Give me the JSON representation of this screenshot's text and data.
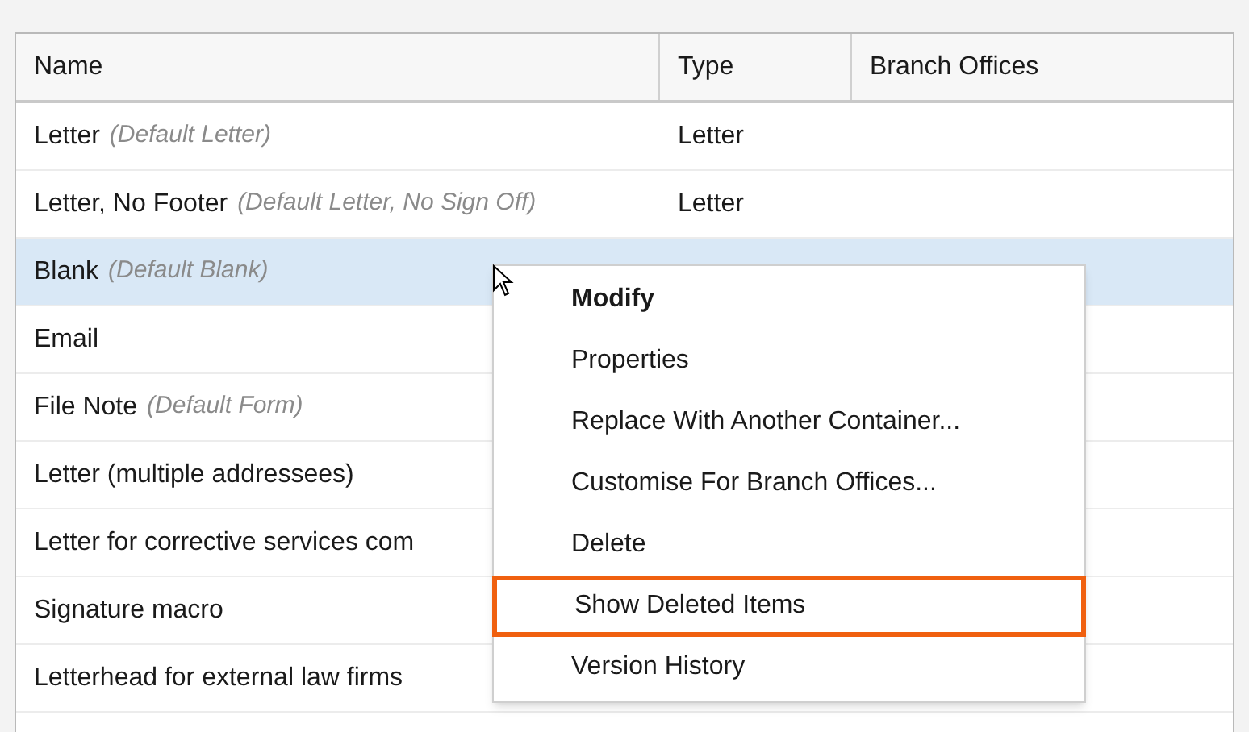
{
  "table": {
    "columns": [
      "Name",
      "Type",
      "Branch Offices"
    ],
    "rows": [
      {
        "name": "Letter",
        "note": "(Default Letter)",
        "type": "Letter",
        "selected": false
      },
      {
        "name": "Letter, No Footer",
        "note": "(Default Letter, No Sign Off)",
        "type": "Letter",
        "selected": false
      },
      {
        "name": "Blank",
        "note": "(Default Blank)",
        "selected": true
      },
      {
        "name": "Email",
        "selected": false
      },
      {
        "name": "File Note",
        "note": "(Default Form)",
        "selected": false
      },
      {
        "name": "Letter (multiple addressees)",
        "selected": false
      },
      {
        "name": "Letter for corrective services com",
        "selected": false
      },
      {
        "name": "Signature macro",
        "selected": false
      },
      {
        "name": "Letterhead for external law firms",
        "selected": false
      }
    ]
  },
  "context_menu": {
    "items": [
      {
        "label": "Modify",
        "default": true,
        "outlined": false
      },
      {
        "label": "Properties",
        "default": false,
        "outlined": false
      },
      {
        "label": "Replace With Another Container...",
        "default": false,
        "outlined": false
      },
      {
        "label": "Customise For Branch Offices...",
        "default": false,
        "outlined": false
      },
      {
        "label": "Delete",
        "default": false,
        "outlined": false
      },
      {
        "label": "Show Deleted Items",
        "default": false,
        "outlined": true
      },
      {
        "label": "Version History",
        "default": false,
        "outlined": false
      }
    ]
  }
}
